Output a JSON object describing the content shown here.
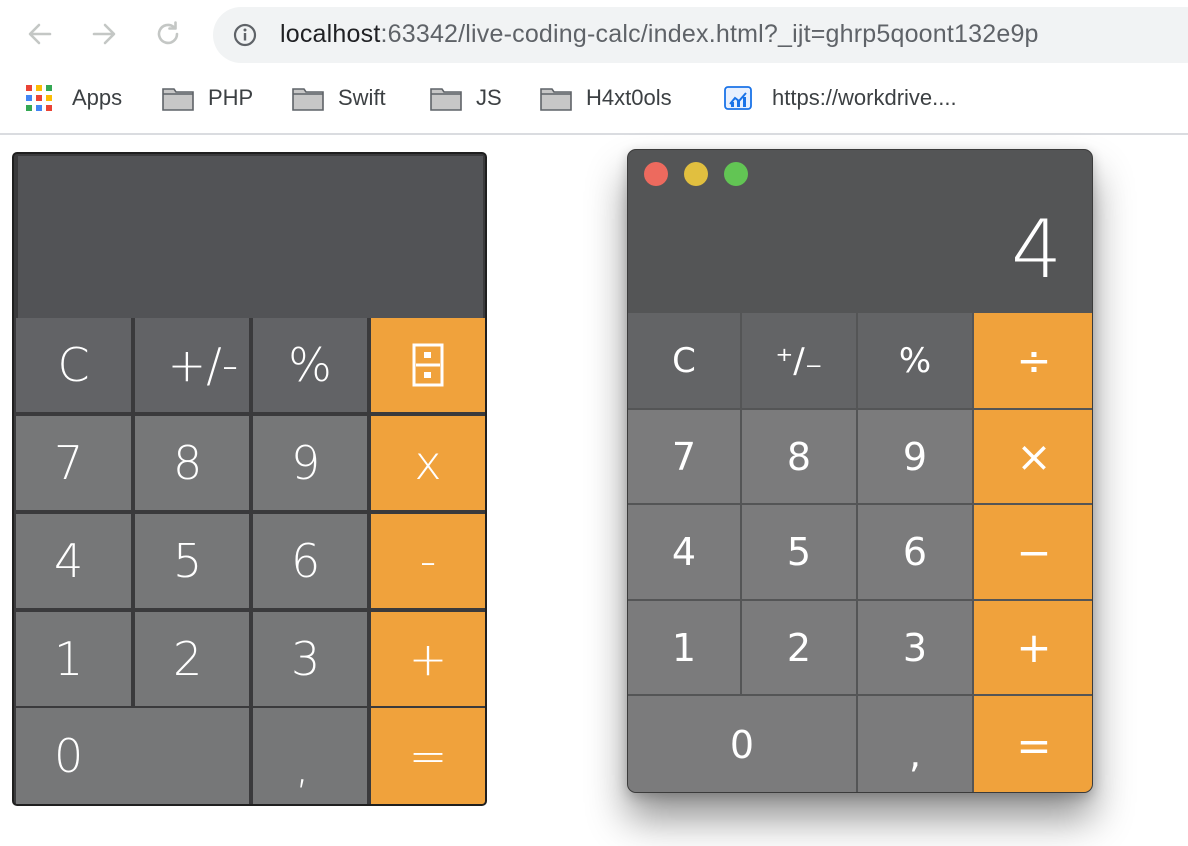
{
  "browser": {
    "url_host": "localhost",
    "url_rest": ":63342/live-coding-calc/index.html?_ijt=ghrp5qoont132e9p",
    "bookmarks": [
      {
        "label": "Apps",
        "icon": "apps-grid-icon"
      },
      {
        "label": "PHP",
        "icon": "folder-icon"
      },
      {
        "label": "Swift",
        "icon": "folder-icon"
      },
      {
        "label": "JS",
        "icon": "folder-icon"
      },
      {
        "label": "H4xt0ols",
        "icon": "folder-icon"
      },
      {
        "label": "https://workdrive....",
        "icon": "workdrive-icon"
      }
    ]
  },
  "left_calc": {
    "display": "",
    "keys": {
      "clear": "C",
      "sign": "+/-",
      "percent": "%",
      "divide_icon": "divide-box-icon",
      "seven": "7",
      "eight": "8",
      "nine": "9",
      "multiply": "x",
      "four": "4",
      "five": "5",
      "six": "6",
      "minus": "-",
      "one": "1",
      "two": "2",
      "three": "3",
      "plus": "+",
      "zero": "0",
      "comma": ",",
      "equals": "="
    }
  },
  "right_calc": {
    "display": "4",
    "keys": {
      "clear": "C",
      "sign": "⁺∕₋",
      "percent": "%",
      "divide": "÷",
      "seven": "7",
      "eight": "8",
      "nine": "9",
      "multiply": "×",
      "four": "4",
      "five": "5",
      "six": "6",
      "minus": "−",
      "one": "1",
      "two": "2",
      "three": "3",
      "plus": "+",
      "zero": "0",
      "comma": ",",
      "equals": "="
    }
  },
  "colors": {
    "operator": "#f0a23c",
    "function_key": "#626366",
    "digit_key": "#767778",
    "display_bg": "#525356",
    "traffic_close": "#ed6a5e",
    "traffic_minimize": "#e1bf3f",
    "traffic_zoom": "#62c554"
  }
}
